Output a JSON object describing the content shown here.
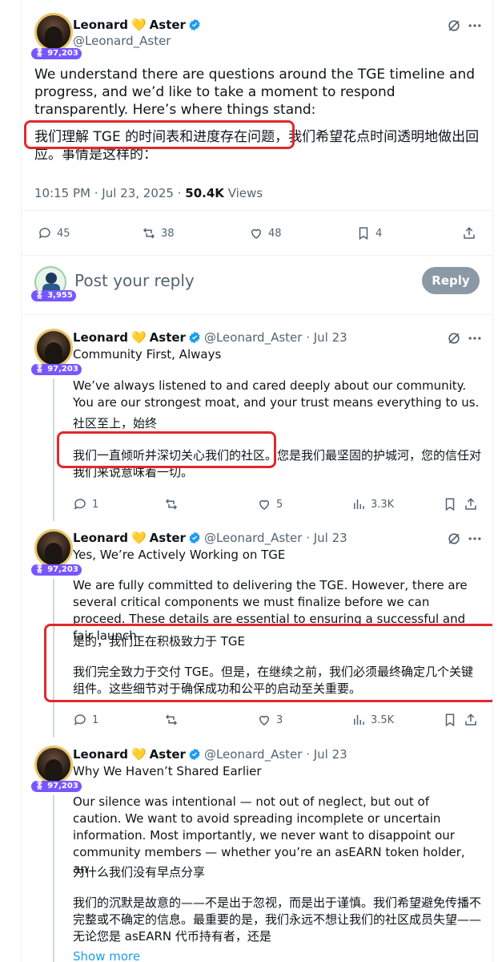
{
  "main_post": {
    "name_first": "Leonard",
    "name_emoji": "💛",
    "name_last": "Aster",
    "handle": "@Leonard_Aster",
    "badge_count": "97,203",
    "text_en": "We understand there are questions around the TGE timeline and progress, and we’d like to take a moment to respond transparently. Here’s where things stand:",
    "text_zh": "我们理解 TGE 的时间表和进度存在问题，我们希望花点时间透明地做出回应。事情是这样的：",
    "timestamp": "10:15 PM · Jul 23, 2025",
    "views_count": "50.4K",
    "views_label": "Views",
    "replies": "45",
    "reposts": "38",
    "likes": "48",
    "bookmarks": "4"
  },
  "reply_box": {
    "placeholder": "Post your reply",
    "button_label": "Reply",
    "badge_count": "3,955"
  },
  "thread": [
    {
      "name_first": "Leonard",
      "name_emoji": "💛",
      "name_last": "Aster",
      "handle_date": "@Leonard_Aster · Jul 23",
      "badge_count": "97,203",
      "title": "Community First, Always",
      "body_en": "We’ve always listened to and cared deeply about our community. You are our strongest moat, and your trust means everything to us.",
      "title_zh": "社区至上，始终",
      "body_zh": "我们一直倾听并深切关心我们的社区。您是我们最坚固的护城河，您的信任对我们来说意味着一切。",
      "replies": "1",
      "reposts": "",
      "likes": "5",
      "views": "3.3K"
    },
    {
      "name_first": "Leonard",
      "name_emoji": "💛",
      "name_last": "Aster",
      "handle_date": "@Leonard_Aster · Jul 23",
      "badge_count": "97,203",
      "title": "Yes, We’re Actively Working on TGE",
      "body_en": "We are fully committed to delivering the TGE. However, there are several critical components we must finalize before we can proceed. These details are essential to ensuring a successful and fair launch.",
      "title_zh": "是的，我们正在积极致力于 TGE",
      "body_zh": "我们完全致力于交付 TGE。但是，在继续之前，我们必须最终确定几个关键组件。这些细节对于确保成功和公平的启动至关重要。",
      "replies": "1",
      "reposts": "",
      "likes": "3",
      "views": "3.5K"
    },
    {
      "name_first": "Leonard",
      "name_emoji": "💛",
      "name_last": "Aster",
      "handle_date": "@Leonard_Aster · Jul 23",
      "badge_count": "97,203",
      "title": "Why We Haven’t Shared Earlier",
      "body_en": "Our silence was intentional — not out of neglect, but out of caution. We want to avoid spreading incomplete or uncertain information. Most importantly, we never want to disappoint our community members — whether you’re an asEARN token holder, an",
      "title_zh": "为什么我们没有早点分享",
      "body_zh": "我们的沉默是故意的——不是出于忽视，而是出于谨慎。我们希望避免传播不完整或不确定的信息。最重要的是，我们永远不想让我们的社区成员失望——无论您是 asEARN 代币持有者，还是",
      "show_more": "Show more"
    }
  ],
  "colors": {
    "accent": "#1d9bf0",
    "highlight_box": "#e0292b",
    "muted_text": "#536471",
    "badge": "#7856ff"
  }
}
